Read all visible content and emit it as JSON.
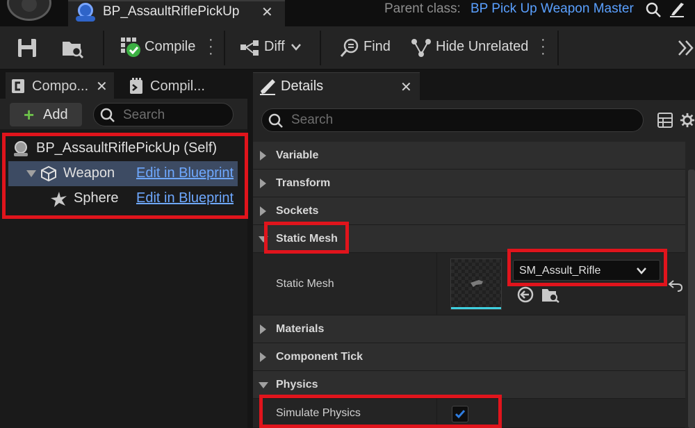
{
  "titlebar": {
    "tab_title": "BP_AssaultRiflePickUp",
    "parent_label": "Parent class:",
    "parent_value": "BP Pick Up Weapon Master"
  },
  "toolbar": {
    "compile_label": "Compile",
    "diff_label": "Diff",
    "find_label": "Find",
    "hide_unrelated_label": "Hide Unrelated"
  },
  "components_panel": {
    "tab_components": "Compo...",
    "tab_compiler": "Compil...",
    "add_label": "Add",
    "search_placeholder": "Search",
    "items": [
      {
        "label": "BP_AssaultRiflePickUp (Self)"
      },
      {
        "label": "Weapon",
        "link": "Edit in Blueprint"
      },
      {
        "label": "Sphere",
        "link": "Edit in Blueprint"
      }
    ]
  },
  "details_panel": {
    "tab_label": "Details",
    "search_placeholder": "Search",
    "categories": {
      "variable": "Variable",
      "transform": "Transform",
      "sockets": "Sockets",
      "static_mesh": "Static Mesh",
      "materials": "Materials",
      "component_tick": "Component Tick",
      "physics": "Physics"
    },
    "properties": {
      "static_mesh_label": "Static Mesh",
      "static_mesh_value": "SM_Assult_Rifle",
      "simulate_physics_label": "Simulate Physics",
      "simulate_physics_checked": true
    }
  },
  "colors": {
    "highlight": "#e0141c",
    "link": "#6ea8ff",
    "selection": "#3d4b63",
    "compile_ok": "#3cb043",
    "add_plus": "#6dc04a"
  }
}
